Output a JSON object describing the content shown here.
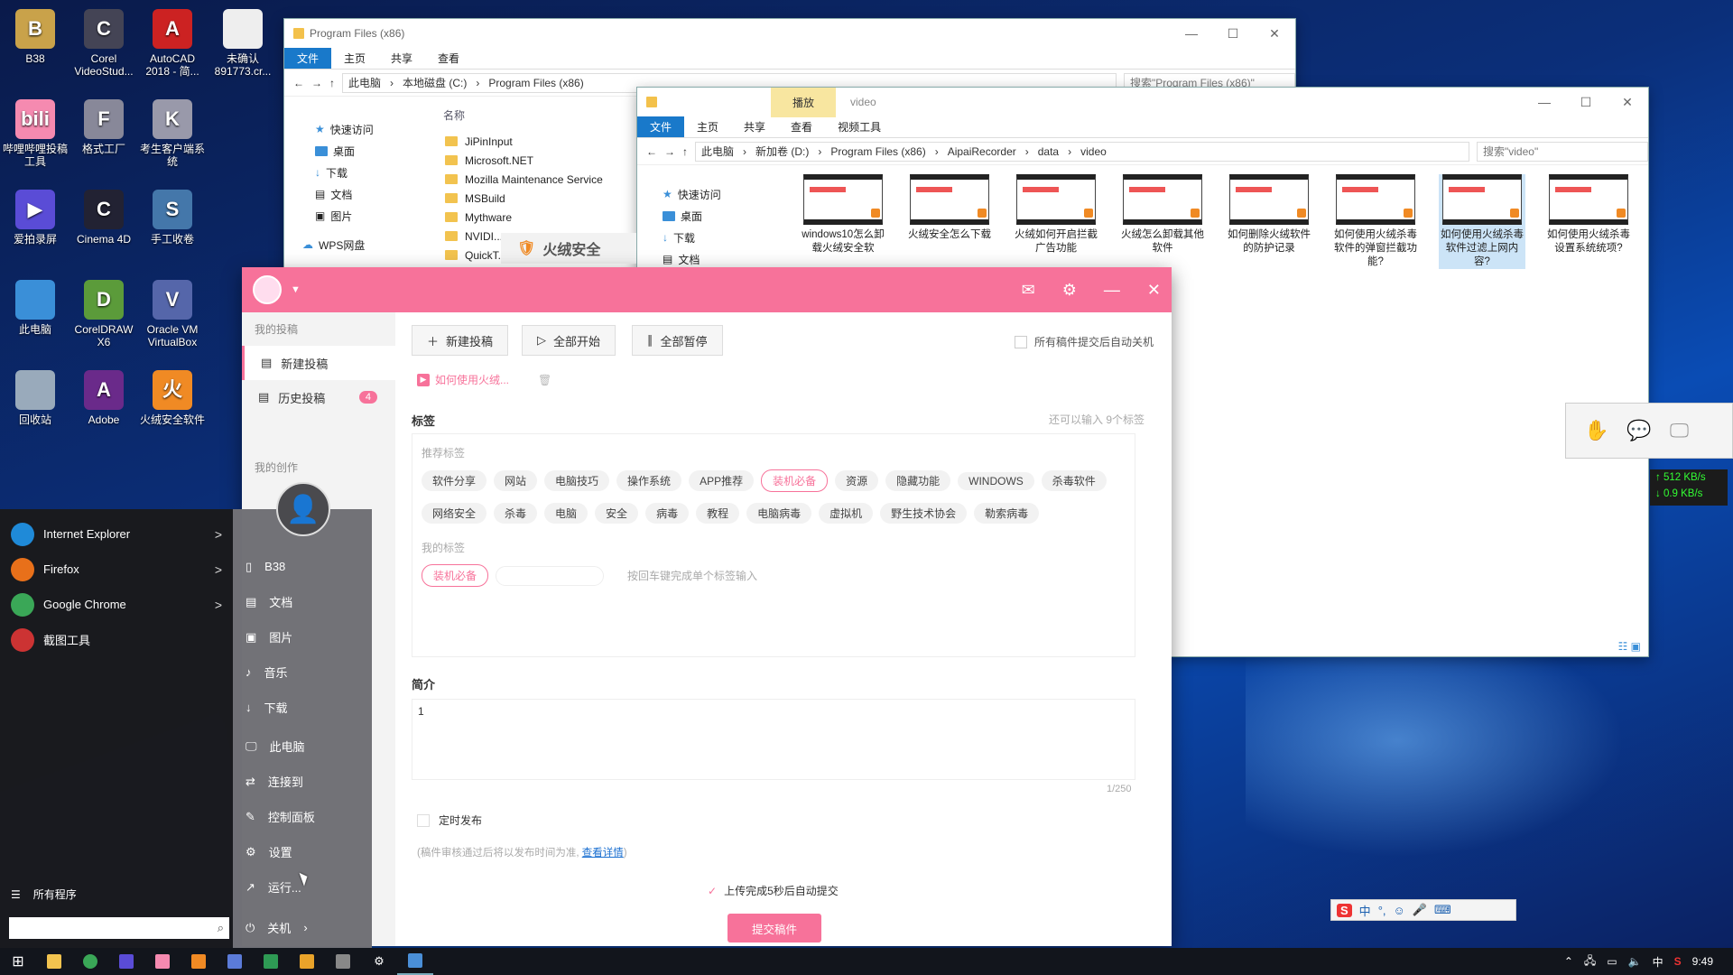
{
  "desktop": {
    "icons": [
      {
        "label": "B38",
        "glyph": "B",
        "color": "#c9a24a"
      },
      {
        "label": "Corel VideoStud...",
        "glyph": "C",
        "color": "#445"
      },
      {
        "label": "AutoCAD 2018 - 简...",
        "glyph": "A",
        "color": "#c22"
      },
      {
        "label": "未确认 891773.cr...",
        "glyph": "",
        "color": "#eee"
      },
      {
        "label": "哔哩哔哩投稿工具",
        "glyph": "bili",
        "color": "#f58ab0"
      },
      {
        "label": "格式工厂",
        "glyph": "F",
        "color": "#889"
      },
      {
        "label": "考生客户端系统",
        "glyph": "K",
        "color": "#99a"
      },
      {
        "label": "爱拍录屏",
        "glyph": "▶",
        "color": "#5a4cd6"
      },
      {
        "label": "Cinema 4D",
        "glyph": "C",
        "color": "#223"
      },
      {
        "label": "手工收卷",
        "glyph": "S",
        "color": "#47a"
      },
      {
        "label": "此电脑",
        "glyph": "",
        "color": "#3a8fd8"
      },
      {
        "label": "CorelDRAW X6",
        "glyph": "D",
        "color": "#5b9b3a"
      },
      {
        "label": "Oracle VM VirtualBox",
        "glyph": "V",
        "color": "#56a"
      },
      {
        "label": "回收站",
        "glyph": "",
        "color": "#9ab"
      },
      {
        "label": "Adobe",
        "glyph": "A",
        "color": "#6a2a8a"
      },
      {
        "label": "火绒安全软件",
        "glyph": "火",
        "color": "#f08a24"
      }
    ]
  },
  "explorer1": {
    "title": "Program Files (x86)",
    "ribbon": [
      "文件",
      "主页",
      "共享",
      "查看"
    ],
    "breadcrumb": [
      "此电脑",
      "本地磁盘 (C:)",
      "Program Files (x86)"
    ],
    "search_placeholder": "搜索\"Program Files (x86)\"",
    "nav": [
      "快速访问",
      "桌面",
      "下载",
      "文档",
      "图片",
      "WPS网盘"
    ],
    "column_header": "名称",
    "folders": [
      "JiPinInput",
      "Microsoft.NET",
      "Mozilla Maintenance Service",
      "MSBuild",
      "Mythware",
      "NVIDI...",
      "QuickT..."
    ]
  },
  "explorer2": {
    "title": "video",
    "context_tab": "播放",
    "context_sub": "视频工具",
    "ribbon": [
      "文件",
      "主页",
      "共享",
      "查看"
    ],
    "breadcrumb": [
      "此电脑",
      "新加卷 (D:)",
      "Program Files (x86)",
      "AipaiRecorder",
      "data",
      "video"
    ],
    "search_placeholder": "搜索\"video\"",
    "nav": [
      "快速访问",
      "桌面",
      "下载",
      "文档"
    ],
    "videos": [
      "windows10怎么卸载火绒安全软",
      "火绒安全怎么下载",
      "火绒如何开启拦截广告功能",
      "火绒怎么卸载其他软件",
      "如何删除火绒软件的防护记录",
      "如何使用火绒杀毒软件的弹窗拦截功能?",
      "如何使用火绒杀毒软件过滤上网内容?",
      "如何使用火绒杀毒设置系统统项?"
    ]
  },
  "huorong_bar": {
    "label": "火绒安全"
  },
  "app": {
    "sidebar": {
      "section1": "我的投稿",
      "new_post": "新建投稿",
      "history": "历史投稿",
      "history_count": "4",
      "section2": "我的创作"
    },
    "toolbar": {
      "new_post": "新建投稿",
      "start_all": "全部开始",
      "pause_all": "全部暂停",
      "auto_shutdown": "所有稿件提交后自动关机"
    },
    "draft_tab": "如何使用火绒...",
    "tags": {
      "title": "标签",
      "remaining": "还可以输入 9个标签",
      "recommended_label": "推荐标签",
      "recommended": [
        "软件分享",
        "网站",
        "电脑技巧",
        "操作系统",
        "APP推荐",
        "装机必备",
        "资源",
        "隐藏功能",
        "WINDOWS",
        "杀毒软件",
        "网络安全",
        "杀毒",
        "电脑",
        "安全",
        "病毒",
        "教程",
        "电脑病毒",
        "虚拟机",
        "野生技术协会",
        "勒索病毒"
      ],
      "selected_recommended": "装机必备",
      "mine_label": "我的标签",
      "mine": [
        "装机必备"
      ],
      "input_hint": "按回车键完成单个标签输入"
    },
    "intro": {
      "title": "简介",
      "value": "1",
      "counter": "1/250"
    },
    "schedule": {
      "label": "定时发布",
      "note": "(稿件审核通过后将以发布时间为准,",
      "link": "查看详情",
      "note_end": ")"
    },
    "auto_submit": "上传完成5秒后自动提交",
    "submit": "提交稿件"
  },
  "start_menu": {
    "apps": [
      {
        "label": "Internet Explorer",
        "color": "#1f8ad8",
        "arrow": ">"
      },
      {
        "label": "Firefox",
        "color": "#e8701a",
        "arrow": ">"
      },
      {
        "label": "Google Chrome",
        "color": "#3aa757",
        "arrow": ">"
      },
      {
        "label": "截图工具",
        "color": "#c33",
        "arrow": ""
      }
    ],
    "all_programs": "所有程序",
    "right": [
      "B38",
      "文档",
      "图片",
      "音乐",
      "下载",
      "此电脑",
      "连接到",
      "控制面板",
      "设置",
      "运行..."
    ],
    "shutdown": "关机"
  },
  "net_speed": {
    "up": "↑ 512 KB/s",
    "down": "↓ 0.9 KB/s"
  },
  "ime": [
    "中",
    "°,",
    "☺",
    "🎤",
    "⌨"
  ],
  "taskbar": {
    "time": "9:49",
    "ime": "中"
  }
}
